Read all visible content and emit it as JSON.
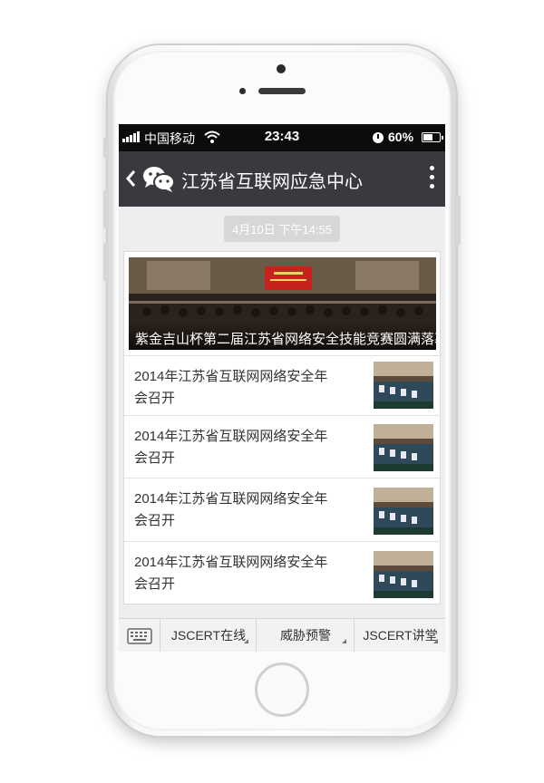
{
  "status_bar": {
    "carrier": "中国移动",
    "time": "23:43",
    "battery_percent": "60%",
    "battery_level": 0.6,
    "icons": [
      "signal-icon",
      "wifi-icon",
      "clock-icon",
      "battery-icon"
    ]
  },
  "nav": {
    "title": "江苏省互联网应急中心",
    "icons": [
      "back-icon",
      "wechat-icon",
      "more-icon"
    ]
  },
  "chat": {
    "timestamp": "4月10日 下午14:55"
  },
  "news": {
    "cover_title": "紫金吉山杯第二届江苏省网络安全技能竞赛圆满落幕",
    "articles": [
      {
        "title": "2014年江苏省互联网网络安全年会召开"
      },
      {
        "title": "2014年江苏省互联网网络安全年会召开"
      },
      {
        "title": "2014年江苏省互联网网络安全年会召开"
      },
      {
        "title": "2014年江苏省互联网网络安全年会召开"
      }
    ]
  },
  "menu": {
    "keyboard_icon": "keyboard-icon",
    "items": [
      {
        "label": "JSCERT在线"
      },
      {
        "label": "威胁预警"
      },
      {
        "label": "JSCERT讲堂"
      }
    ]
  },
  "colors": {
    "nav_background": "#393a3f",
    "status_background": "#0c0c0c",
    "chat_background": "#eeeeee"
  }
}
